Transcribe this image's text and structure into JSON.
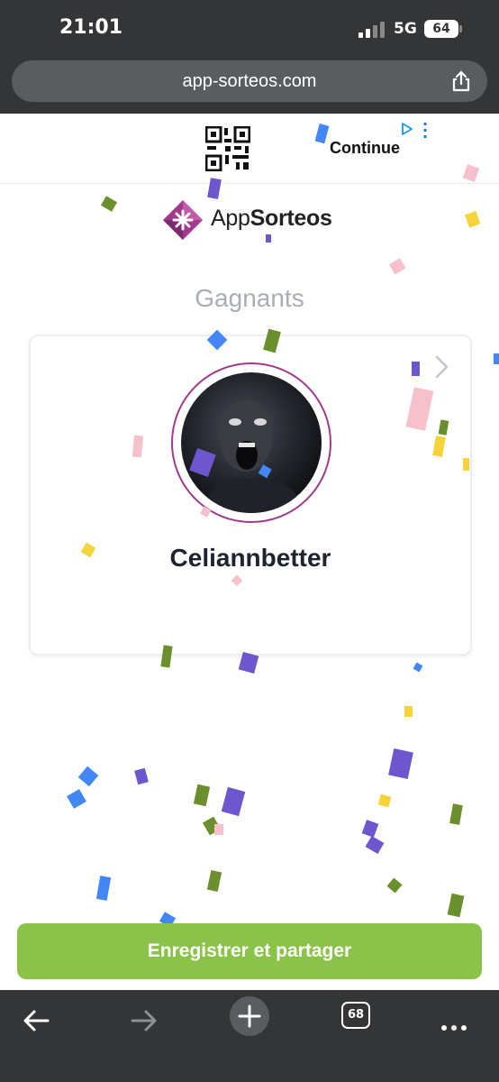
{
  "status": {
    "time": "21:01",
    "network": "5G",
    "battery": "64"
  },
  "browser": {
    "url": "app-sorteos.com",
    "tab_count": "68"
  },
  "ad": {
    "cta": "Continue"
  },
  "brand": {
    "name_regular": "App",
    "name_bold": "Sorteos",
    "accent": "#a13a8e"
  },
  "section": {
    "title": "Gagnants"
  },
  "winner": {
    "name": "Celiannbetter"
  },
  "action": {
    "label": "Enregistrer et partager",
    "color": "#8bc34a"
  },
  "icons": [
    "share-icon",
    "qr-code-icon",
    "ad-choices-icon",
    "chevron-right-icon",
    "back-arrow-icon",
    "forward-arrow-icon",
    "new-tab-plus-icon",
    "more-dots-icon"
  ]
}
